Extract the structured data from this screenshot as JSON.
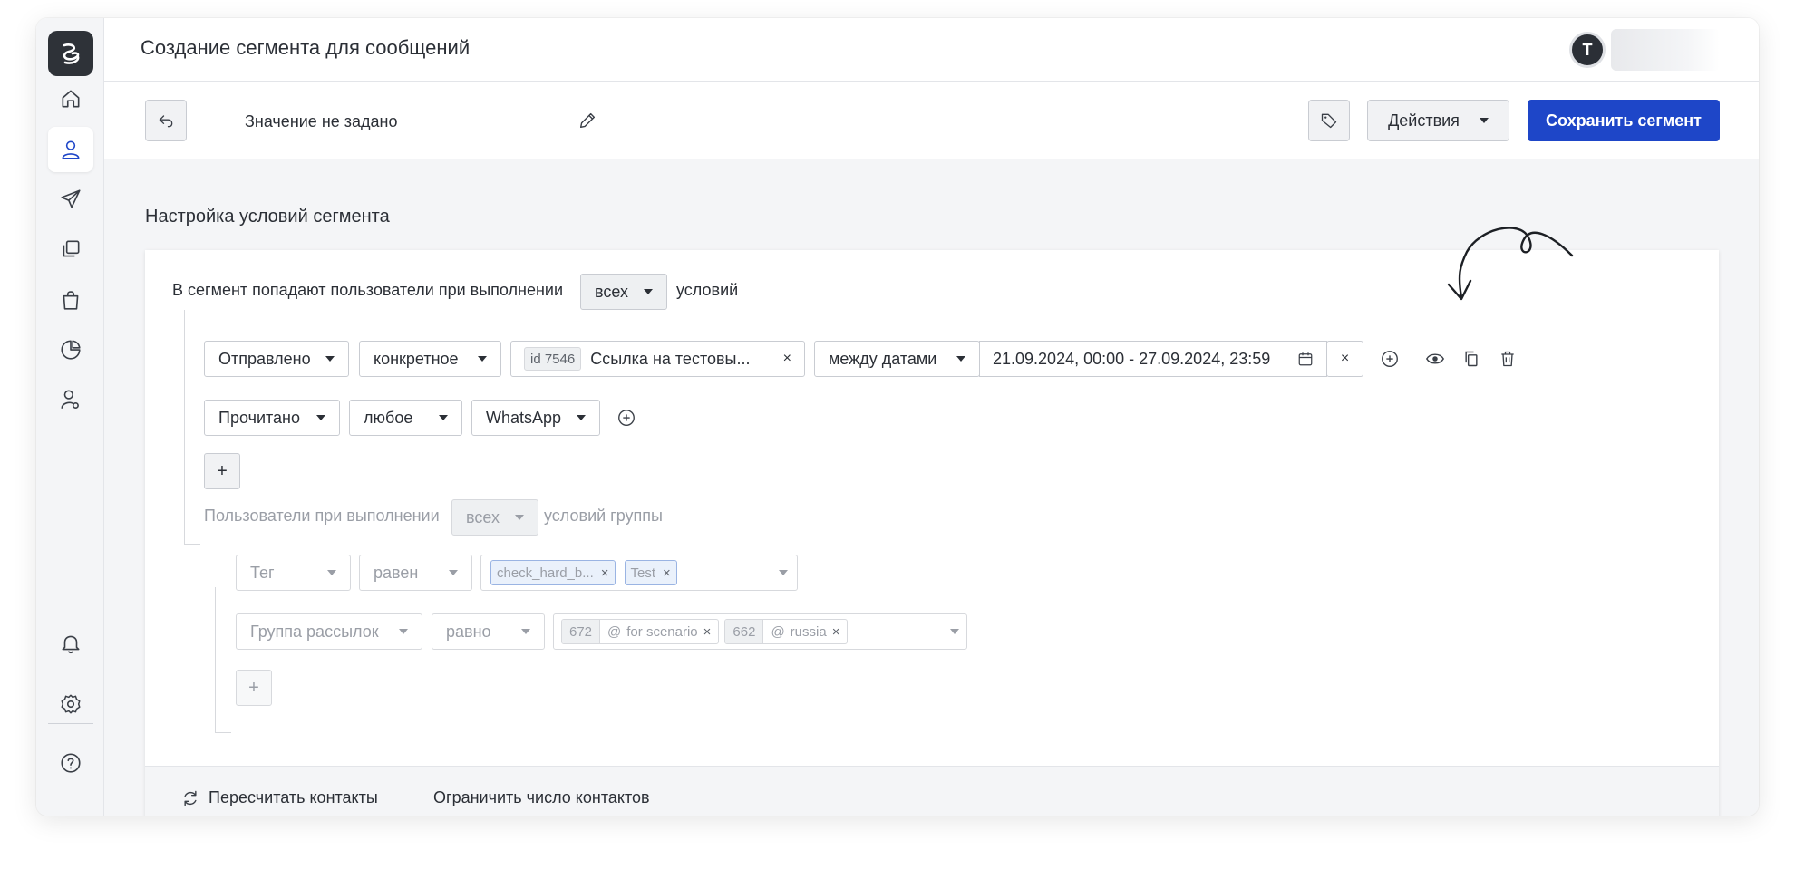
{
  "app": {
    "title": "Создание сегмента для сообщений",
    "avatar_letter": "T"
  },
  "sidebar": {
    "items": [
      {
        "icon": "home-icon"
      },
      {
        "icon": "user-icon",
        "active": true
      },
      {
        "icon": "send-icon"
      },
      {
        "icon": "copy-icon"
      },
      {
        "icon": "shopping-bag-icon"
      },
      {
        "icon": "pie-chart-icon"
      },
      {
        "icon": "user-settings-icon"
      },
      {
        "icon": "bell-icon"
      },
      {
        "icon": "gear-icon"
      },
      {
        "icon": "help-icon"
      }
    ]
  },
  "toolbar": {
    "segment_name": "Значение не задано",
    "actions_label": "Действия",
    "save_label": "Сохранить сегмент"
  },
  "main": {
    "section_title": "Настройка условий сегмента",
    "root": {
      "prefix": "В сегмент попадают пользователи при выполнении",
      "mode": "всех",
      "suffix": "условий",
      "conditions": [
        {
          "field": "Отправлено",
          "operator": "конкретное",
          "message_id": "id 7546",
          "message_name": "Ссылка на тестовы...",
          "date_mode": "между датами",
          "date_range": "21.09.2024, 00:00 - 27.09.2024, 23:59"
        },
        {
          "field": "Прочитано",
          "operator": "любое",
          "channel": "WhatsApp"
        }
      ],
      "add_label": "+"
    },
    "group": {
      "prefix": "Пользователи при выполнении",
      "mode": "всех",
      "suffix": "условий группы",
      "conditions": [
        {
          "field": "Тег",
          "operator": "равен",
          "tags": [
            "check_hard_b...",
            "Test"
          ]
        },
        {
          "field": "Группа рассылок",
          "operator": "равно",
          "groups": [
            {
              "id": "672",
              "name": "for scenario"
            },
            {
              "id": "662",
              "name": "russia"
            }
          ]
        }
      ],
      "add_label": "+"
    },
    "footer": {
      "recalc_label": "Пересчитать контакты",
      "limit_label": "Ограничить число контактов"
    }
  }
}
